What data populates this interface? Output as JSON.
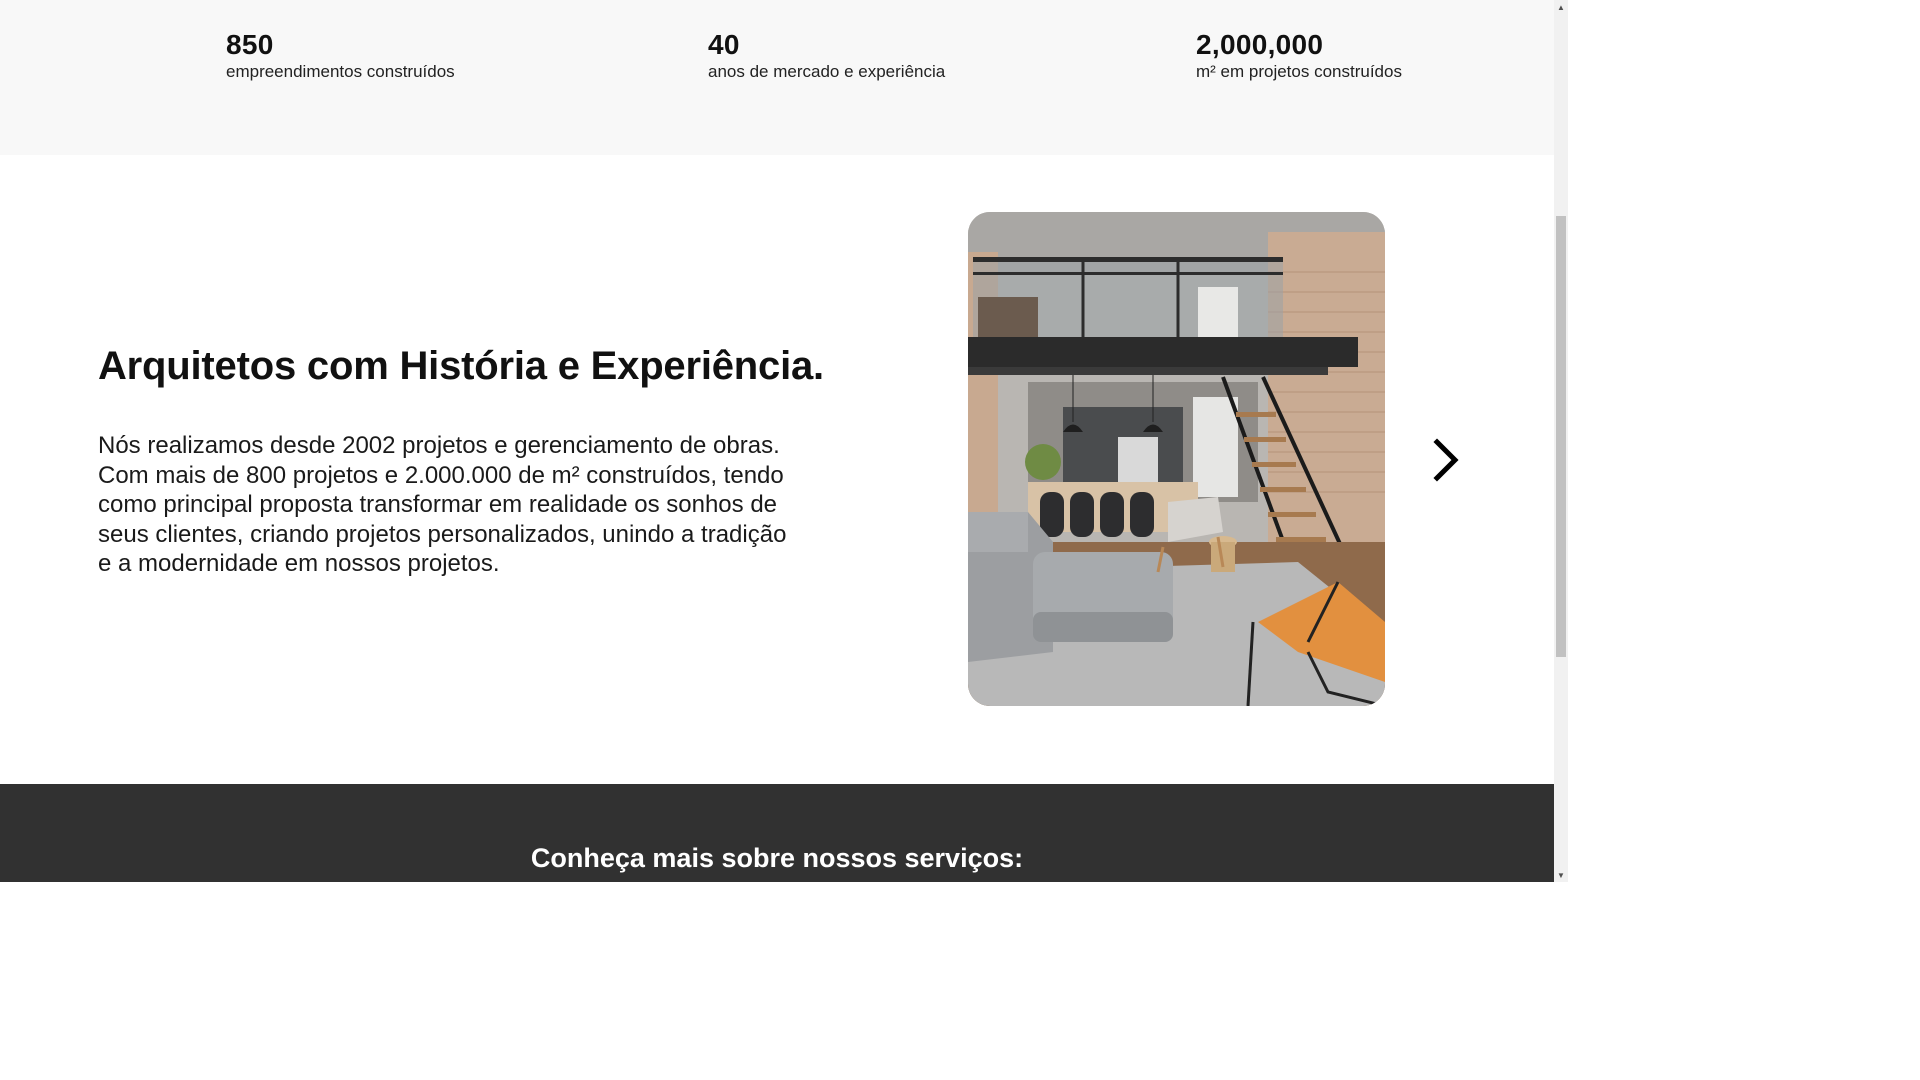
{
  "stats": [
    {
      "value": "850",
      "label": "empreendimentos construídos"
    },
    {
      "value": "40",
      "label": "anos de mercado e experiência"
    },
    {
      "value": "2,000,000",
      "label": "m² em projetos construídos"
    }
  ],
  "about": {
    "title": "Arquitetos com História e Experiência.",
    "text_lines": [
      "Nós realizamos desde 2002 projetos e gerenciamento de obras.",
      "Com mais de 800 projetos e 2.000.000 de m² construídos, tendo",
      "como principal proposta transformar em realidade os sonhos de",
      "seus clientes, criando projetos personalizados, unindo a tradição",
      "e a modernidade em nossos projetos."
    ],
    "image_icon": "loft-interior-photo",
    "next_icon": "chevron-right-icon"
  },
  "services": {
    "title": "Conheça mais sobre nossos serviços:"
  },
  "scrollbar": {
    "up_icon": "scroll-up-arrow",
    "down_icon": "scroll-down-arrow"
  },
  "colors": {
    "stats_bg": "#f8f8f8",
    "dark_section": "#313131",
    "accent_chair": "#e2903f"
  }
}
